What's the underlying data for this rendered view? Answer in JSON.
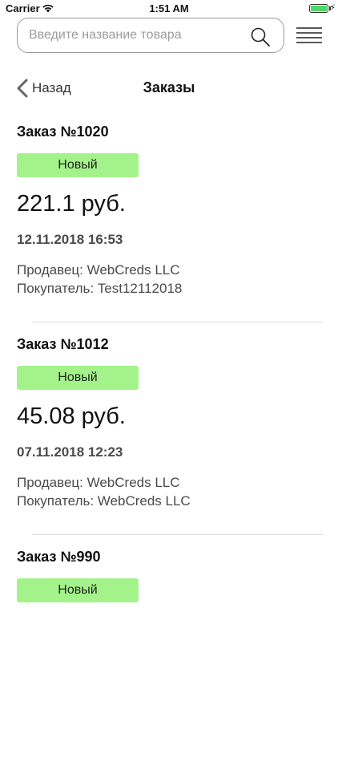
{
  "status_bar": {
    "carrier": "Carrier",
    "time": "1:51 AM",
    "battery_level": 1.0
  },
  "search": {
    "placeholder": "Введите название товара",
    "value": ""
  },
  "nav": {
    "back_label": "Назад",
    "title": "Заказы"
  },
  "orders": [
    {
      "title": "Заказ №1020",
      "status": "Новый",
      "price": "221.1 руб.",
      "date": "12.11.2018 16:53",
      "seller": "Продавец: WebCreds LLC",
      "buyer": "Покупатель: Test12112018"
    },
    {
      "title": "Заказ №1012",
      "status": "Новый",
      "price": "45.08 руб.",
      "date": "07.11.2018 12:23",
      "seller": "Продавец: WebCreds LLC",
      "buyer": "Покупатель: WebCreds LLC"
    },
    {
      "title": "Заказ №990",
      "status": "Новый",
      "price": "",
      "date": "",
      "seller": "",
      "buyer": ""
    }
  ],
  "colors": {
    "status_badge": "#a4f38a",
    "battery": "#4cd964"
  }
}
